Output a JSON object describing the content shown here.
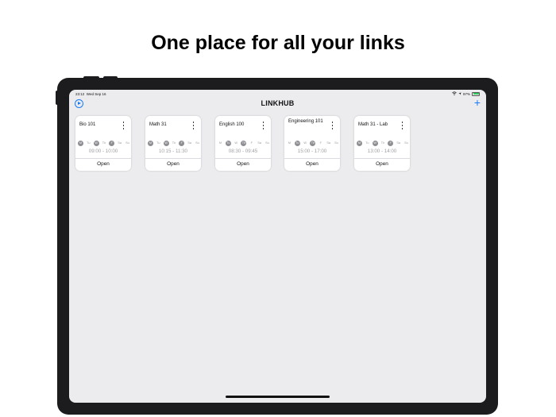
{
  "headline": "One place for all your links",
  "statusbar": {
    "time": "23:12",
    "date": "Wed Sep 16",
    "battery": "97%",
    "battery_level": 0.97
  },
  "nav": {
    "title": "LINKHUB",
    "plus_label": "+",
    "left_icon": "play-circle-icon"
  },
  "cards": [
    {
      "title": "Bio 101",
      "days": [
        {
          "label": "M",
          "on": true
        },
        {
          "label": "Tu",
          "on": false
        },
        {
          "label": "W",
          "on": true
        },
        {
          "label": "Th",
          "on": false
        },
        {
          "label": "F",
          "on": true
        },
        {
          "label": "Sa",
          "on": false
        },
        {
          "label": "Su",
          "on": false
        }
      ],
      "time": "09:00 - 10:00",
      "open_label": "Open"
    },
    {
      "title": "Math 31",
      "days": [
        {
          "label": "M",
          "on": true
        },
        {
          "label": "Tu",
          "on": false
        },
        {
          "label": "W",
          "on": true
        },
        {
          "label": "Th",
          "on": false
        },
        {
          "label": "F",
          "on": true
        },
        {
          "label": "Sa",
          "on": false
        },
        {
          "label": "Su",
          "on": false
        }
      ],
      "time": "10:15 - 11:30",
      "open_label": "Open"
    },
    {
      "title": "English 100",
      "days": [
        {
          "label": "M",
          "on": false
        },
        {
          "label": "Tu",
          "on": true
        },
        {
          "label": "W",
          "on": false
        },
        {
          "label": "Th",
          "on": true
        },
        {
          "label": "F",
          "on": false
        },
        {
          "label": "Sa",
          "on": false
        },
        {
          "label": "Su",
          "on": false
        }
      ],
      "time": "08:30 - 09:45",
      "open_label": "Open"
    },
    {
      "title": "Engineering 101",
      "days": [
        {
          "label": "M",
          "on": false
        },
        {
          "label": "Tu",
          "on": true
        },
        {
          "label": "W",
          "on": false
        },
        {
          "label": "Th",
          "on": true
        },
        {
          "label": "F",
          "on": false
        },
        {
          "label": "Sa",
          "on": false
        },
        {
          "label": "Su",
          "on": false
        }
      ],
      "time": "15:00 - 17:00",
      "open_label": "Open"
    },
    {
      "title": "Math 31 - Lab",
      "days": [
        {
          "label": "M",
          "on": true
        },
        {
          "label": "Tu",
          "on": false
        },
        {
          "label": "W",
          "on": true
        },
        {
          "label": "Th",
          "on": false
        },
        {
          "label": "F",
          "on": true
        },
        {
          "label": "Sa",
          "on": false
        },
        {
          "label": "Su",
          "on": false
        }
      ],
      "time": "13:00 - 14:00",
      "open_label": "Open"
    }
  ],
  "colors": {
    "accent": "#1a7bf2",
    "screen_bg": "#ececef",
    "day_on": "#8e8e93"
  }
}
